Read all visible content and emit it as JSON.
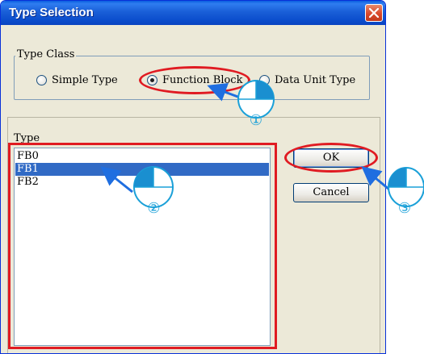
{
  "window": {
    "title": "Type Selection"
  },
  "type_class": {
    "legend": "Type Class",
    "options": [
      {
        "label": "Simple Type",
        "selected": false
      },
      {
        "label": "Function Block",
        "selected": true
      },
      {
        "label": "Data Unit Type",
        "selected": false
      }
    ]
  },
  "type_list": {
    "label": "Type",
    "items": [
      {
        "label": "FB0",
        "selected": false
      },
      {
        "label": "FB1",
        "selected": true
      },
      {
        "label": "FB2",
        "selected": false
      }
    ]
  },
  "buttons": {
    "ok": "OK",
    "cancel": "Cancel"
  },
  "steps": [
    "①",
    "②",
    "③"
  ],
  "colors": {
    "titlebar": "#0a4fd4",
    "dialog_bg": "#ece9d8",
    "selection": "#316ac5",
    "callout": "#e01b22",
    "arrow": "#1f6ee0",
    "marker": "#1aa0d8"
  }
}
